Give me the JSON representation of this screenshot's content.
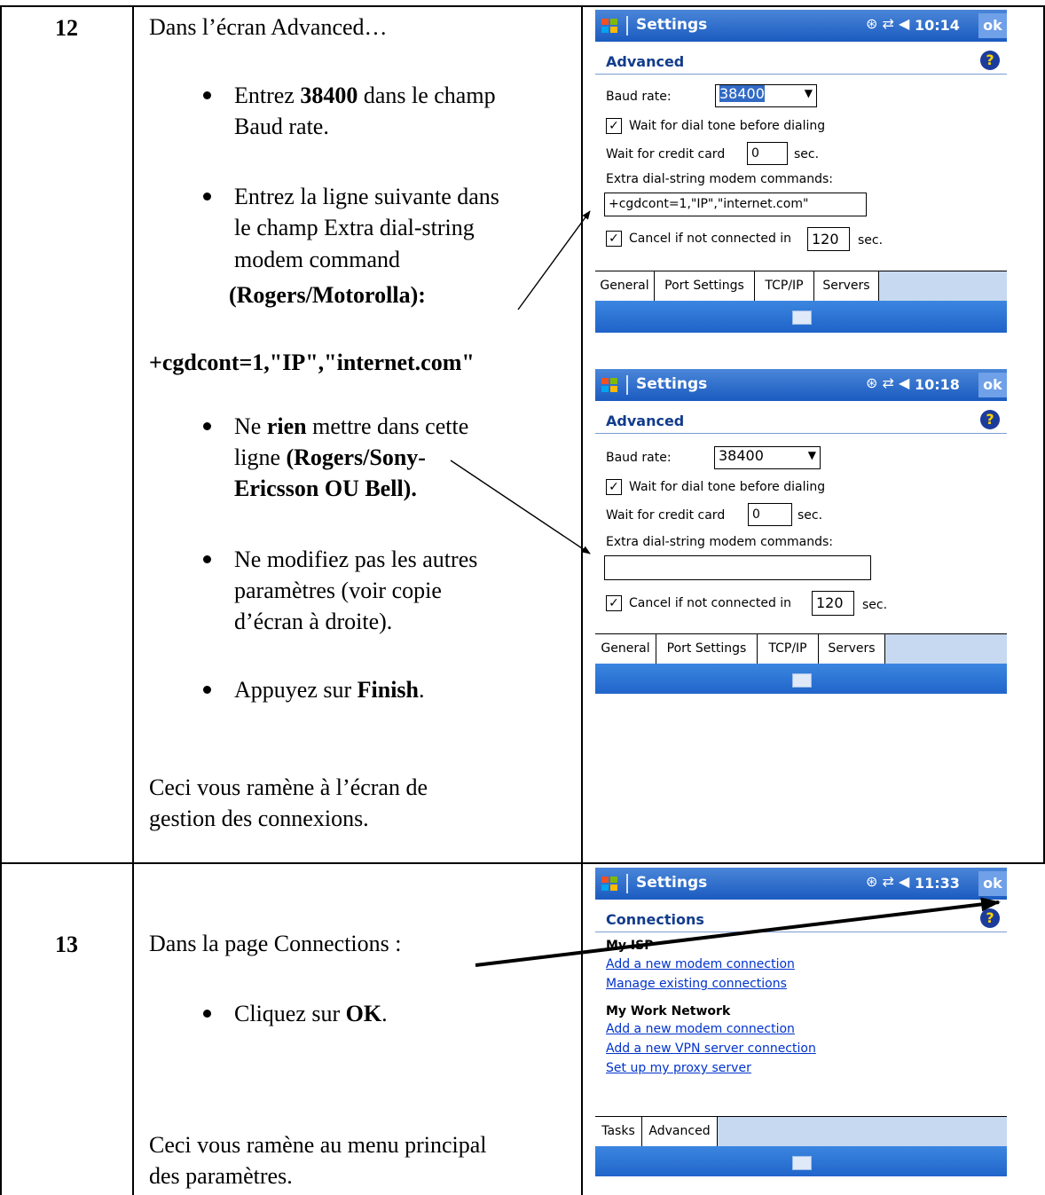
{
  "step12": {
    "number": "12",
    "intro": "Dans l’écran Advanced…",
    "b1_pre": "Entrez ",
    "b1_bold": "38400",
    "b1_post": " dans le champ",
    "b1_line2": "Baud rate.",
    "b2_line1": "Entrez la ligne suivante dans",
    "b2_line2": "le champ Extra dial-string",
    "b2_line3": "modem command",
    "b2_line4": "(Rogers/Motorolla):",
    "command": "+cgdcont=1,\"IP\",\"internet.com\"",
    "b3_pre": "Ne ",
    "b3_bold": "rien",
    "b3_post": " mettre dans cette",
    "b3_line2_pre": "ligne ",
    "b3_line2_bold": "(Rogers/Sony-",
    "b3_line3": "Ericsson OU Bell).",
    "b4_line1": "Ne modifiez pas les autres",
    "b4_line2": "paramètres (voir copie",
    "b4_line3": "d’écran à droite).",
    "b5_pre": "Appuyez sur ",
    "b5_bold": "Finish",
    "b5_post": ".",
    "outro_line1": "Ceci vous ramène à l’écran de",
    "outro_line2": "gestion des connexions."
  },
  "step13": {
    "number": "13",
    "intro": "Dans la page Connections :",
    "b1_pre": "Cliquez sur ",
    "b1_bold": "OK",
    "b1_post": ".",
    "outro_line1": "Ceci vous ramène au menu principal",
    "outro_line2": "des paramètres."
  },
  "screen1": {
    "title": "Settings",
    "time": "10:14",
    "ok": "ok",
    "heading": "Advanced",
    "help": "?",
    "baud_label": "Baud rate:",
    "baud_value": "38400",
    "wait_dial": "Wait for dial tone before dialing",
    "wait_card_label": "Wait for credit card",
    "wait_card_value": "0",
    "sec": "sec.",
    "extra_label": "Extra dial-string modem commands:",
    "extra_value": "+cgdcont=1,\"IP\",\"internet.com\"",
    "cancel_label": "Cancel if not connected in",
    "cancel_value": "120",
    "tabs": [
      "General",
      "Port Settings",
      "TCP/IP",
      "Servers"
    ]
  },
  "screen2": {
    "title": "Settings",
    "time": "10:18",
    "ok": "ok",
    "heading": "Advanced",
    "help": "?",
    "baud_label": "Baud rate:",
    "baud_value": "38400",
    "wait_dial": "Wait for dial tone before dialing",
    "wait_card_label": "Wait for credit card",
    "wait_card_value": "0",
    "sec": "sec.",
    "extra_label": "Extra dial-string modem commands:",
    "extra_value": "",
    "cancel_label": "Cancel if not connected in",
    "cancel_value": "120",
    "tabs": [
      "General",
      "Port Settings",
      "TCP/IP",
      "Servers"
    ]
  },
  "screen3": {
    "title": "Settings",
    "time": "11:33",
    "ok": "ok",
    "heading": "Connections",
    "help": "?",
    "isp_title": "My ISP",
    "isp_links": [
      "Add a new modem connection",
      "Manage existing connections"
    ],
    "work_title": "My Work Network",
    "work_links": [
      "Add a new modem connection",
      "Add a new VPN server connection",
      "Set up my proxy server"
    ],
    "tabs": [
      "Tasks",
      "Advanced"
    ]
  }
}
